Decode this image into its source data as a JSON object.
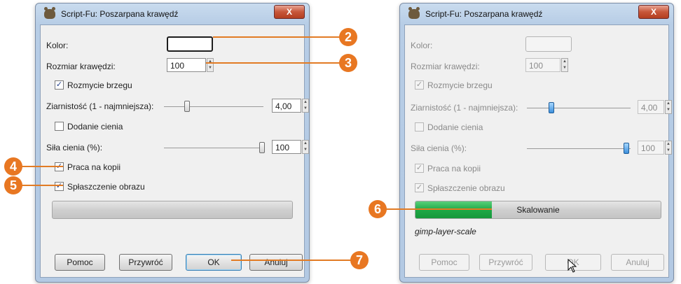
{
  "dialog": {
    "title": "Script-Fu: Poszarpana krawędź",
    "close_label": "X",
    "color_label": "Kolor:",
    "edge_size_label": "Rozmiar krawędzi:",
    "edge_size_value": "100",
    "blur_edge_label": "Rozmycie brzegu",
    "grain_label": "Ziarnistość (1 - najmniejsza):",
    "grain_value": "4,00",
    "shadow_label": "Dodanie cienia",
    "shadow_strength_label": "Siła cienia (%):",
    "shadow_strength_value": "100",
    "copy_label": "Praca na kopii",
    "flatten_label": "Spłaszczenie obrazu",
    "buttons": {
      "help": "Pomoc",
      "reset": "Przywróć",
      "ok": "OK",
      "cancel": "Anuluj"
    }
  },
  "checkmark": "✓",
  "right_dialog": {
    "progress_text": "Skalowanie",
    "progress_fraction": 0.31,
    "procedure_name": "gimp-layer-scale"
  },
  "callouts": [
    "2",
    "3",
    "4",
    "5",
    "6",
    "7"
  ],
  "colors": {
    "callout": "#e87722",
    "progress": "#1fa846"
  }
}
